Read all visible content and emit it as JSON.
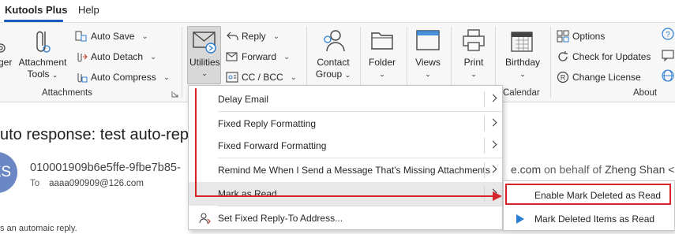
{
  "tabs": [
    {
      "label": "Kutools Plus",
      "active": true
    },
    {
      "label": "Help",
      "active": false
    }
  ],
  "ribbon": {
    "partial_left_label": "ger",
    "attachment_tools": {
      "line1": "Attachment",
      "line2": "Tools"
    },
    "auto_save": "Auto Save",
    "auto_detach": "Auto Detach",
    "auto_compress": "Auto Compress",
    "group_attachments": "Attachments",
    "utilities": "Utilities",
    "reply": "Reply",
    "forward": "Forward",
    "cc_bcc": "CC / BCC",
    "contact_group": {
      "line1": "Contact",
      "line2": "Group"
    },
    "folder": "Folder",
    "views": "Views",
    "print": "Print",
    "birthday": "Birthday",
    "group_calendar": "Calendar",
    "options": "Options",
    "check_updates": "Check for Updates",
    "change_license": "Change License",
    "group_about": "About"
  },
  "email": {
    "subject": "uto response: test auto-reply",
    "avatar_initials": "ZS",
    "sender": "010001909b6e5ffe-9fbe7b85-",
    "sender_domain_tail": "e.com",
    "on_behalf_of": "on behalf of",
    "behalf_name": "Zheng Shan <",
    "to_label": "To",
    "to_address": "aaaa090909@126.com",
    "body_preview": "s an automaic reply."
  },
  "menu": {
    "items": [
      {
        "label": "Delay Email",
        "has_submenu": true
      },
      {
        "label": "Fixed Reply Formatting",
        "has_submenu": true
      },
      {
        "label": "Fixed Forward Formatting",
        "has_submenu": true
      },
      {
        "label": "Remind Me When I Send a Message That's Missing Attachments",
        "has_submenu": true
      },
      {
        "label": "Mark as Read",
        "has_submenu": true
      },
      {
        "label": "Set Fixed Reply-To Address...",
        "has_submenu": false
      }
    ]
  },
  "submenu": {
    "items": [
      {
        "label": "Enable Mark Deleted as Read",
        "highlighted": true
      },
      {
        "label": "Mark Deleted Items as Read",
        "highlighted": false
      }
    ]
  },
  "colors": {
    "accent": "#185abd",
    "annotation_red": "#d6252a",
    "avatar_bg": "#6b88c4"
  }
}
